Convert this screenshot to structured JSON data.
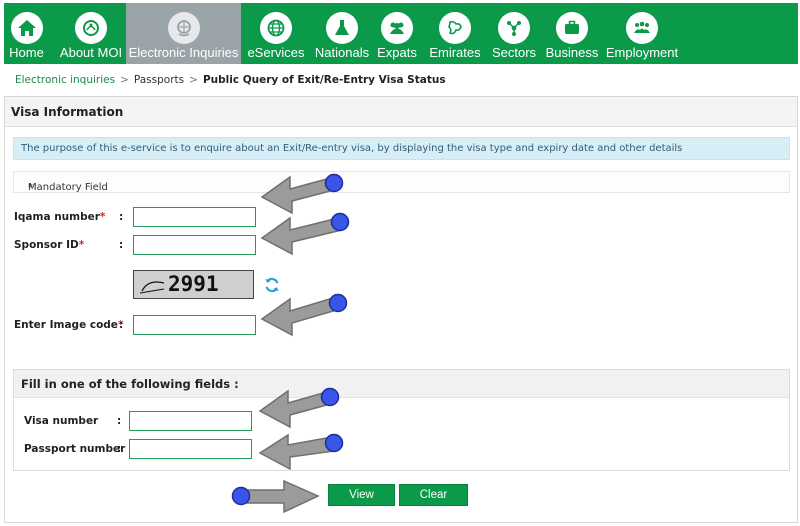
{
  "nav": {
    "items": [
      {
        "label": "Home",
        "icon": "home-icon"
      },
      {
        "label": "About MOI",
        "icon": "emblem-icon"
      },
      {
        "label": "Electronic Inquiries",
        "icon": "globe-hand-icon"
      },
      {
        "label": "eServices",
        "icon": "globe-icon"
      },
      {
        "label": "Nationals",
        "icon": "flask-icon"
      },
      {
        "label": "Expats",
        "icon": "people-icon"
      },
      {
        "label": "Emirates",
        "icon": "map-icon"
      },
      {
        "label": "Sectors",
        "icon": "share-icon"
      },
      {
        "label": "Business",
        "icon": "briefcase-icon"
      },
      {
        "label": "Employment",
        "icon": "group-icon"
      }
    ],
    "active": "Electronic Inquiries",
    "brand_color": "#0b9a4a"
  },
  "breadcrumb": {
    "items": [
      "Electronic inquiries",
      "Passports",
      "Public Query of Exit/Re-Entry Visa Status"
    ]
  },
  "panel": {
    "title": "Visa Information",
    "info_text": "The purpose of this e-service is to enquire about an Exit/Re-entry visa, by displaying the visa type and expiry date and other details",
    "mandatory_note": "Mandatory Field",
    "asterisk": "*"
  },
  "form": {
    "iqama_label": "Iqama number",
    "sponsor_label": "Sponsor ID",
    "captcha_text": "2991",
    "image_code_label": "Enter Image code",
    "colon": ":"
  },
  "alt_fields": {
    "heading": "Fill in one of the following fields :",
    "visa_label": "Visa number",
    "passport_label": "Passport number"
  },
  "buttons": {
    "view": "View",
    "clear": "Clear"
  }
}
